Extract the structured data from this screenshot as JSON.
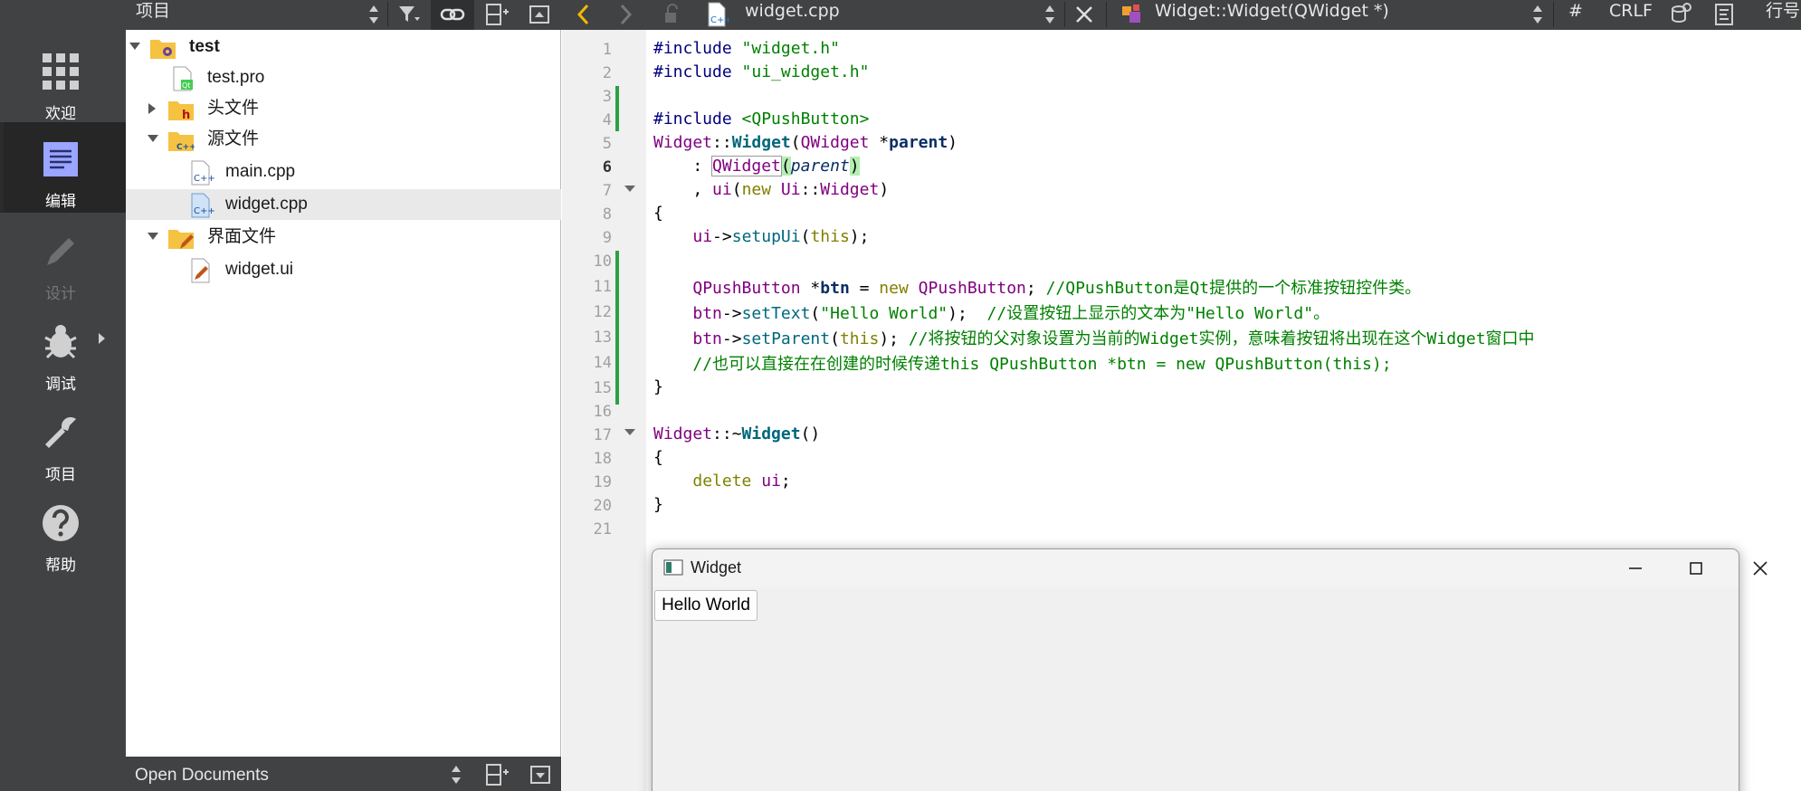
{
  "toolbar": {
    "project_combo": "项目",
    "file_combo": "widget.cpp",
    "symbol_combo": "Widget::Widget(QWidget *)",
    "hash": "#",
    "line_ending": "CRLF",
    "line_info": "行号"
  },
  "modes": [
    {
      "label": "欢迎",
      "icon": "grid-icon"
    },
    {
      "label": "编辑",
      "icon": "edit-doc-icon"
    },
    {
      "label": "设计",
      "icon": "pencil-icon"
    },
    {
      "label": "调试",
      "icon": "bug-icon"
    },
    {
      "label": "项目",
      "icon": "wrench-icon"
    },
    {
      "label": "帮助",
      "icon": "help-icon"
    }
  ],
  "tree": {
    "root": "test",
    "pro_file": "test.pro",
    "headers": "头文件",
    "sources": "源文件",
    "main_cpp": "main.cpp",
    "widget_cpp": "widget.cpp",
    "forms": "界面文件",
    "widget_ui": "widget.ui"
  },
  "open_documents": "Open Documents",
  "code": {
    "line_numbers": [
      "1",
      "2",
      "3",
      "4",
      "5",
      "6",
      "7",
      "8",
      "9",
      "10",
      "11",
      "12",
      "13",
      "14",
      "15",
      "16",
      "17",
      "18",
      "19",
      "20",
      "21"
    ],
    "l1_dir": "#include ",
    "l1_str": "\"widget.h\"",
    "l2_dir": "#include ",
    "l2_str": "\"ui_widget.h\"",
    "l4_dir": "#include ",
    "l4_str": "<QPushButton>",
    "l5_a": "Widget",
    "l5_b": "::",
    "l5_c": "Widget",
    "l5_d": "(",
    "l5_e": "QWidget",
    "l5_f": " *",
    "l5_g": "parent",
    "l5_h": ")",
    "l6_a": "    : ",
    "l6_b": "QWidget",
    "l6_c": "(",
    "l6_d": "parent",
    "l6_e": ")",
    "l7_a": "    , ",
    "l7_b": "ui",
    "l7_c": "(",
    "l7_d": "new",
    "l7_e": " ",
    "l7_f": "Ui",
    "l7_g": "::",
    "l7_h": "Widget",
    "l7_i": ")",
    "l8": "{",
    "l9_a": "    ",
    "l9_b": "ui",
    "l9_c": "->",
    "l9_d": "setupUi",
    "l9_e": "(",
    "l9_f": "this",
    "l9_g": ");",
    "l11_a": "    ",
    "l11_b": "QPushButton",
    "l11_c": " *",
    "l11_d": "btn",
    "l11_e": " = ",
    "l11_f": "new",
    "l11_g": " ",
    "l11_h": "QPushButton",
    "l11_i": "; ",
    "l11_j": "//QPushButton是Qt提供的一个标准按钮控件类。",
    "l12_a": "    ",
    "l12_b": "btn",
    "l12_c": "->",
    "l12_d": "setText",
    "l12_e": "(",
    "l12_f": "\"Hello World\"",
    "l12_g": ");  ",
    "l12_h": "//设置按钮上显示的文本为\"Hello World\"。",
    "l13_a": "    ",
    "l13_b": "btn",
    "l13_c": "->",
    "l13_d": "setParent",
    "l13_e": "(",
    "l13_f": "this",
    "l13_g": "); ",
    "l13_h": "//将按钮的父对象设置为当前的Widget实例，意味着按钮将出现在这个Widget窗口中",
    "l14_a": "    ",
    "l14_b": "//也可以直接在在创建的时候传递this QPushButton *btn = new QPushButton(this);",
    "l15": "}",
    "l17_a": "Widget",
    "l17_b": "::~",
    "l17_c": "Widget",
    "l17_d": "()",
    "l18": "{",
    "l19_a": "    ",
    "l19_b": "delete",
    "l19_c": " ",
    "l19_d": "ui",
    "l19_e": ";",
    "l20": "}"
  },
  "widget_window": {
    "title": "Widget",
    "button_text": "Hello World"
  }
}
